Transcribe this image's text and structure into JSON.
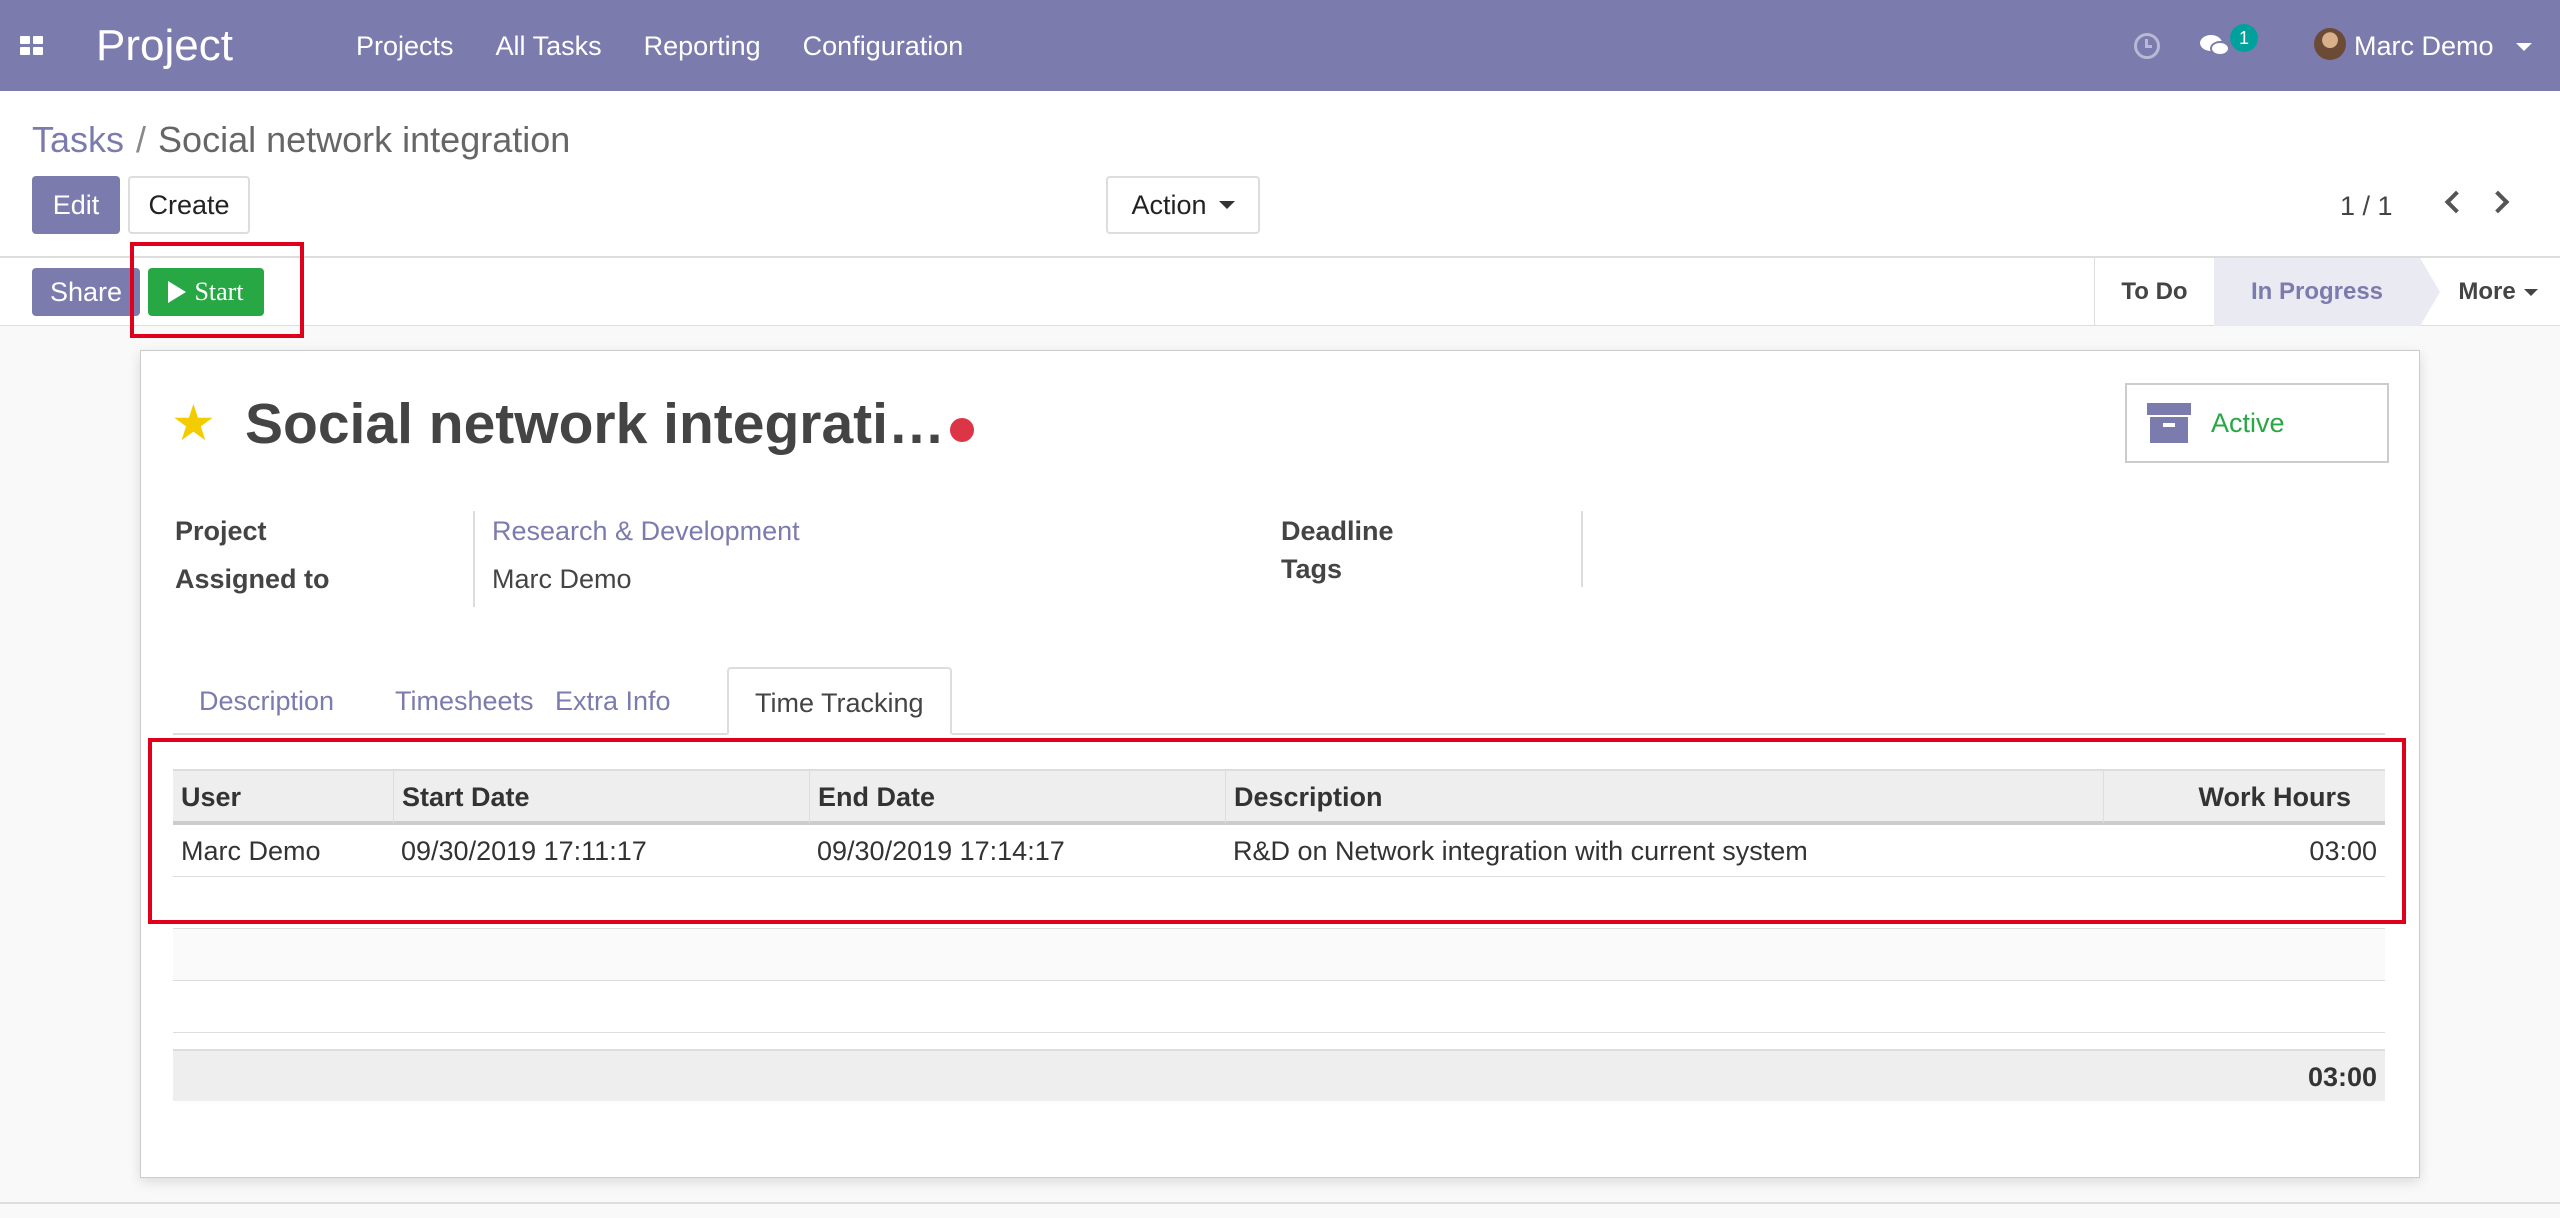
{
  "navbar": {
    "app_title": "Project",
    "menu": [
      "Projects",
      "All Tasks",
      "Reporting",
      "Configuration"
    ],
    "messages_count": "1",
    "user_name": "Marc Demo",
    "bg_color": "#7c7bad"
  },
  "breadcrumb": {
    "parent": "Tasks",
    "separator": "/",
    "current": "Social network integration"
  },
  "buttons": {
    "edit": "Edit",
    "create": "Create",
    "action": "Action",
    "share": "Share",
    "start": "Start"
  },
  "pager": {
    "value": "1 / 1"
  },
  "stages": {
    "todo": "To Do",
    "in_progress": "In Progress",
    "more": "More",
    "current": "In Progress"
  },
  "task": {
    "title": "Social network integrati…",
    "starred": true,
    "kanban_state_color": "#dc3545",
    "archive_label": "Active",
    "fields": {
      "project_label": "Project",
      "project_value": "Research & Development",
      "assigned_label": "Assigned to",
      "assigned_value": "Marc Demo",
      "deadline_label": "Deadline",
      "tags_label": "Tags"
    }
  },
  "tabs": {
    "items": [
      "Description",
      "Timesheets",
      "Extra Info",
      "Time Tracking"
    ],
    "active": "Time Tracking"
  },
  "time_tracking": {
    "columns": [
      "User",
      "Start Date",
      "End Date",
      "Description",
      "Work Hours"
    ],
    "rows": [
      {
        "user": "Marc Demo",
        "start_date": "09/30/2019 17:11:17",
        "end_date": "09/30/2019 17:14:17",
        "description": "R&D on Network integration with current system",
        "work_hours": "03:00"
      }
    ],
    "total": "03:00"
  },
  "colors": {
    "accent": "#7c7bad",
    "start_green": "#28a745",
    "star": "#f3cc00",
    "annotation_red": "#e0001b"
  }
}
